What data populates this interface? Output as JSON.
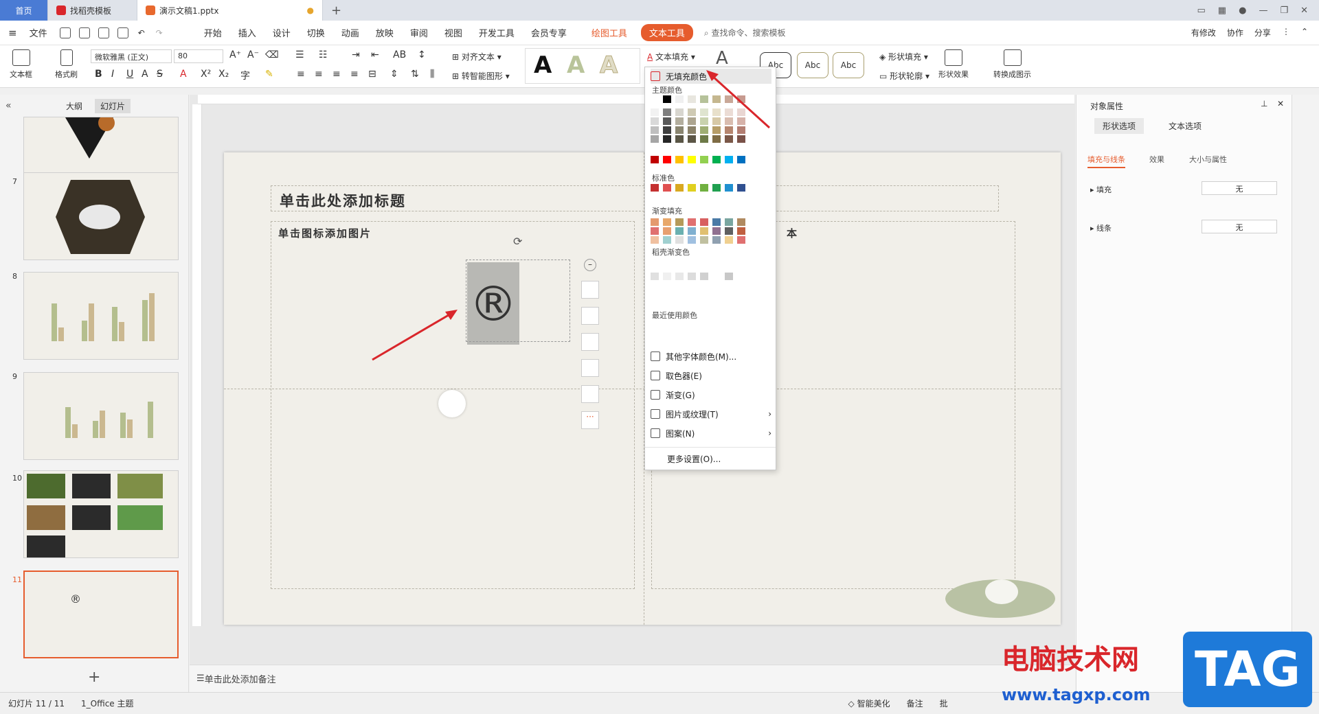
{
  "tabs": {
    "home": "首页",
    "template": "找稻壳模板",
    "doc": "演示文稿1.pptx"
  },
  "menu": [
    "文件",
    "开始",
    "插入",
    "设计",
    "切换",
    "动画",
    "放映",
    "审阅",
    "视图",
    "开发工具",
    "会员专享",
    "绘图工具",
    "文本工具"
  ],
  "search_placeholder": "查找命令、搜索模板",
  "menu_right": [
    "有修改",
    "协作",
    "分享"
  ],
  "ribbon": {
    "textbox": "文本框",
    "format_painter": "格式刷",
    "font": "微软雅黑 (正文)",
    "size": "80",
    "align_text": "对齐文本",
    "smart_art": "转智能图形",
    "text_fill": "文本填充",
    "shape_fill": "形状填充",
    "shape_outline": "形状轮廓",
    "shape_effect": "形状效果",
    "convert": "转换成图示",
    "abc": "Abc"
  },
  "pane_tabs": {
    "outline": "大纲",
    "slides": "幻灯片"
  },
  "slide_numbers": [
    "7",
    "8",
    "9",
    "10",
    "11"
  ],
  "slide": {
    "title": "单击此处添加标题",
    "left_hint": "单击图标添加图片",
    "right_hint": "本",
    "symbol": "®"
  },
  "dropdown": {
    "no_fill": "无填充颜色",
    "theme": "主题颜色",
    "standard": "标准色",
    "gradient": "渐变填充",
    "docer": "稻壳渐变色",
    "recent": "最近使用颜色",
    "items": [
      "其他字体颜色(M)...",
      "取色器(E)",
      "渐变(G)",
      "图片或纹理(T)",
      "图案(N)",
      "更多设置(O)..."
    ]
  },
  "props": {
    "title": "对象属性",
    "tab_shape": "形状选项",
    "tab_text": "文本选项",
    "sub1": "填充与线条",
    "sub2": "效果",
    "sub3": "大小与属性",
    "fill": "填充",
    "line": "线条",
    "none": "无"
  },
  "notes": "单击此处添加备注",
  "status": {
    "slide": "幻灯片 11 / 11",
    "theme": "1_Office 主题",
    "beautify": "智能美化",
    "notes": "备注",
    "comment": "批"
  },
  "watermark": {
    "cn": "电脑技术网",
    "url": "www.tagxp.com",
    "tag": "TAG"
  },
  "colors": {
    "accent": "#e65c2d",
    "home": "#4a7bd4",
    "arrow": "#d9262b"
  }
}
